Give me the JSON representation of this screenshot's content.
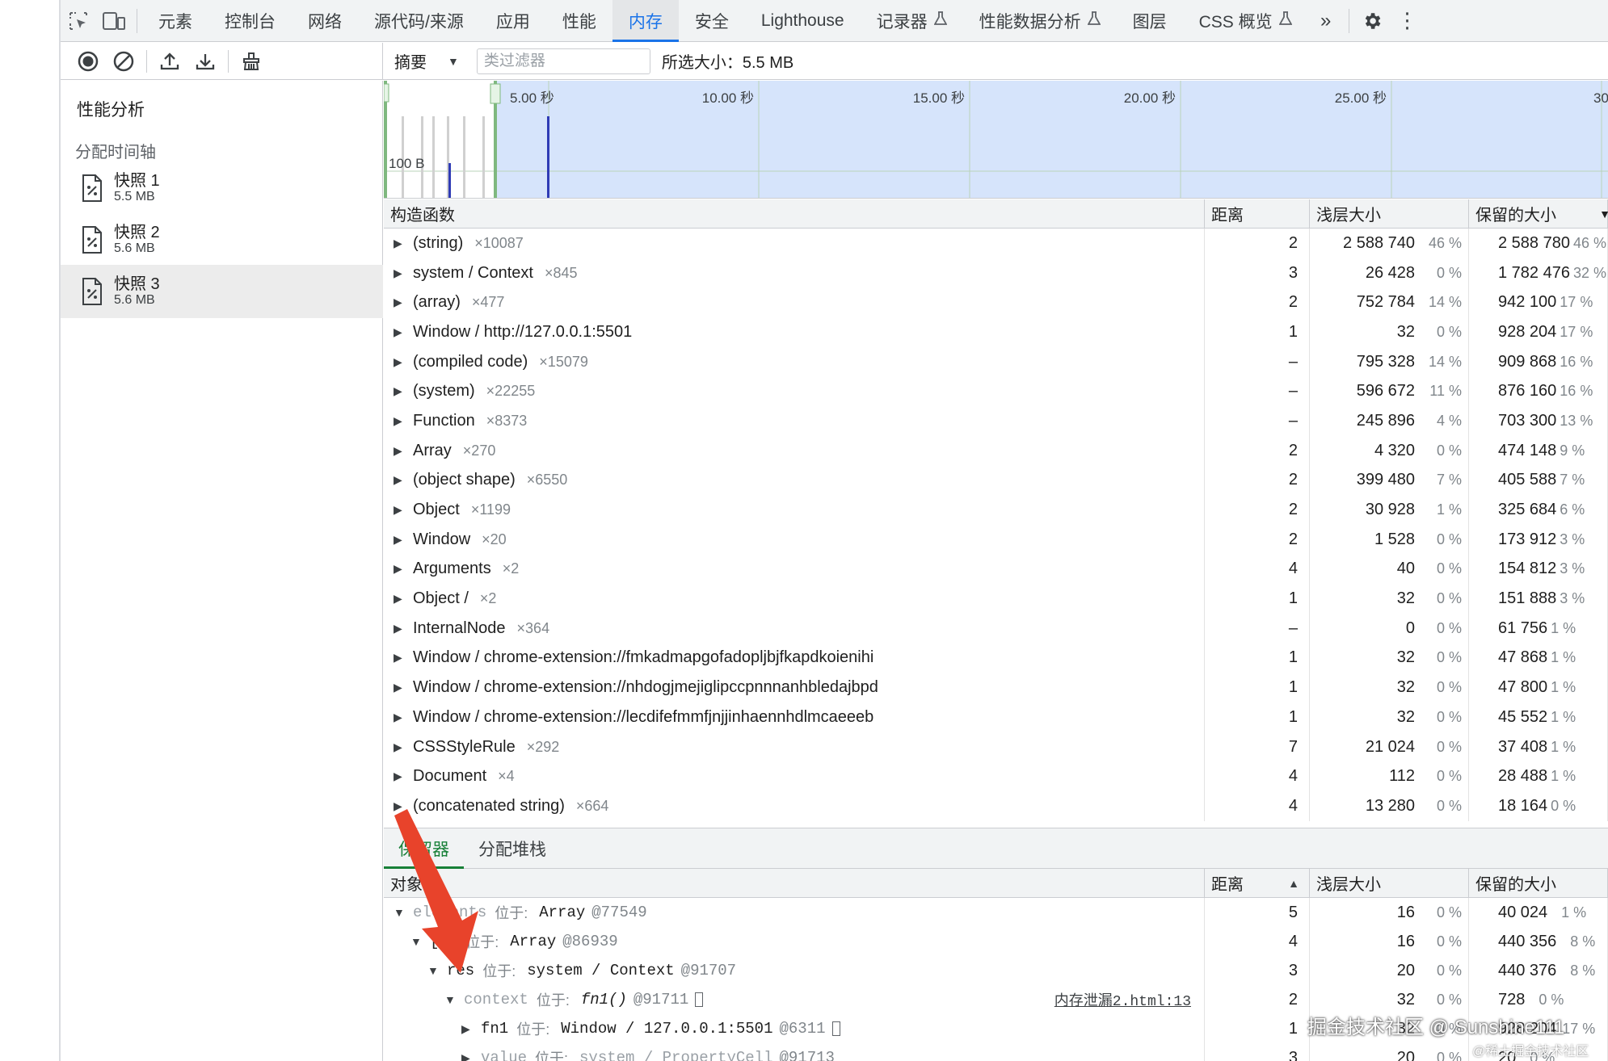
{
  "tabs": [
    {
      "label": "元素",
      "active": false,
      "flask": false
    },
    {
      "label": "控制台",
      "active": false,
      "flask": false
    },
    {
      "label": "网络",
      "active": false,
      "flask": false
    },
    {
      "label": "源代码/来源",
      "active": false,
      "flask": false
    },
    {
      "label": "应用",
      "active": false,
      "flask": false
    },
    {
      "label": "性能",
      "active": false,
      "flask": false
    },
    {
      "label": "内存",
      "active": true,
      "flask": false
    },
    {
      "label": "安全",
      "active": false,
      "flask": false
    },
    {
      "label": "Lighthouse",
      "active": false,
      "flask": false
    },
    {
      "label": "记录器",
      "active": false,
      "flask": true
    },
    {
      "label": "性能数据分析",
      "active": false,
      "flask": true
    },
    {
      "label": "图层",
      "active": false,
      "flask": false
    },
    {
      "label": "CSS 概览",
      "active": false,
      "flask": true
    }
  ],
  "toolbar": {
    "view_select": "摘要",
    "filter_placeholder": "类过滤器",
    "selected_size": "所选大小：5.5 MB"
  },
  "sidebar": {
    "title": "性能分析",
    "section": "分配时间轴",
    "snapshots": [
      {
        "name": "快照 1",
        "size": "5.5 MB",
        "selected": false
      },
      {
        "name": "快照 2",
        "size": "5.6 MB",
        "selected": false
      },
      {
        "name": "快照 3",
        "size": "5.6 MB",
        "selected": true
      }
    ]
  },
  "timeline": {
    "ticks": [
      "5.00 秒",
      "10.00 秒",
      "15.00 秒",
      "20.00 秒",
      "25.00 秒",
      "30"
    ],
    "y_label": "100 B"
  },
  "table": {
    "headers": {
      "name": "构造函数",
      "distance": "距离",
      "shallow": "浅层大小",
      "retained": "保留的大小"
    },
    "rows": [
      {
        "name": "(string)",
        "count": "×10087",
        "distance": "2",
        "shallow": "2 588 740",
        "shallow_pct": "46 %",
        "retained": "2 588 780",
        "retained_pct": "46 %"
      },
      {
        "name": "system / Context",
        "count": "×845",
        "distance": "3",
        "shallow": "26 428",
        "shallow_pct": "0 %",
        "retained": "1 782 476",
        "retained_pct": "32 %"
      },
      {
        "name": "(array)",
        "count": "×477",
        "distance": "2",
        "shallow": "752 784",
        "shallow_pct": "14 %",
        "retained": "942 100",
        "retained_pct": "17 %"
      },
      {
        "name": "Window / http://127.0.0.1:5501",
        "count": "",
        "distance": "1",
        "shallow": "32",
        "shallow_pct": "0 %",
        "retained": "928 204",
        "retained_pct": "17 %"
      },
      {
        "name": "(compiled code)",
        "count": "×15079",
        "distance": "–",
        "shallow": "795 328",
        "shallow_pct": "14 %",
        "retained": "909 868",
        "retained_pct": "16 %"
      },
      {
        "name": "(system)",
        "count": "×22255",
        "distance": "–",
        "shallow": "596 672",
        "shallow_pct": "11 %",
        "retained": "876 160",
        "retained_pct": "16 %"
      },
      {
        "name": "Function",
        "count": "×8373",
        "distance": "–",
        "shallow": "245 896",
        "shallow_pct": "4 %",
        "retained": "703 300",
        "retained_pct": "13 %"
      },
      {
        "name": "Array",
        "count": "×270",
        "distance": "2",
        "shallow": "4 320",
        "shallow_pct": "0 %",
        "retained": "474 148",
        "retained_pct": "9 %"
      },
      {
        "name": "(object shape)",
        "count": "×6550",
        "distance": "2",
        "shallow": "399 480",
        "shallow_pct": "7 %",
        "retained": "405 588",
        "retained_pct": "7 %"
      },
      {
        "name": "Object",
        "count": "×1199",
        "distance": "2",
        "shallow": "30 928",
        "shallow_pct": "1 %",
        "retained": "325 684",
        "retained_pct": "6 %"
      },
      {
        "name": "Window",
        "count": "×20",
        "distance": "2",
        "shallow": "1 528",
        "shallow_pct": "0 %",
        "retained": "173 912",
        "retained_pct": "3 %"
      },
      {
        "name": "Arguments",
        "count": "×2",
        "distance": "4",
        "shallow": "40",
        "shallow_pct": "0 %",
        "retained": "154 812",
        "retained_pct": "3 %"
      },
      {
        "name": "Object /",
        "count": "×2",
        "distance": "1",
        "shallow": "32",
        "shallow_pct": "0 %",
        "retained": "151 888",
        "retained_pct": "3 %"
      },
      {
        "name": "InternalNode",
        "count": "×364",
        "distance": "–",
        "shallow": "0",
        "shallow_pct": "0 %",
        "retained": "61 756",
        "retained_pct": "1 %"
      },
      {
        "name": "Window / chrome-extension://fmkadmapgofadopljbjfkapdkoienihi",
        "count": "",
        "distance": "1",
        "shallow": "32",
        "shallow_pct": "0 %",
        "retained": "47 868",
        "retained_pct": "1 %"
      },
      {
        "name": "Window / chrome-extension://nhdogjmejiglipccpnnnanhbledajbpd",
        "count": "",
        "distance": "1",
        "shallow": "32",
        "shallow_pct": "0 %",
        "retained": "47 800",
        "retained_pct": "1 %"
      },
      {
        "name": "Window / chrome-extension://lecdifefmmfjnjjinhaennhdlmcaeeeb",
        "count": "",
        "distance": "1",
        "shallow": "32",
        "shallow_pct": "0 %",
        "retained": "45 552",
        "retained_pct": "1 %"
      },
      {
        "name": "CSSStyleRule",
        "count": "×292",
        "distance": "7",
        "shallow": "21 024",
        "shallow_pct": "0 %",
        "retained": "37 408",
        "retained_pct": "1 %"
      },
      {
        "name": "Document",
        "count": "×4",
        "distance": "4",
        "shallow": "112",
        "shallow_pct": "0 %",
        "retained": "28 488",
        "retained_pct": "1 %"
      },
      {
        "name": "(concatenated string)",
        "count": "×664",
        "distance": "4",
        "shallow": "13 280",
        "shallow_pct": "0 %",
        "retained": "18 164",
        "retained_pct": "0 %"
      }
    ]
  },
  "bottom": {
    "tabs": [
      "保留器",
      "分配堆栈"
    ],
    "headers": {
      "name": "对象",
      "distance": "距离",
      "shallow": "浅层大小",
      "retained": "保留的大小"
    },
    "rows": [
      {
        "indent": 0,
        "open": true,
        "prop": "elements",
        "dim": true,
        "at": "位于:",
        "obj": "Array",
        "obj_dim": false,
        "italic": false,
        "id": "@77549",
        "link": "",
        "distance": "5",
        "shallow": "16",
        "shallow_pct": "0 %",
        "retained": "40 024",
        "retained_pct": "1 %"
      },
      {
        "indent": 1,
        "open": true,
        "prop": "[1]",
        "dim": false,
        "at": "位于:",
        "obj": "Array",
        "obj_dim": false,
        "italic": false,
        "id": "@86939",
        "link": "",
        "distance": "4",
        "shallow": "16",
        "shallow_pct": "0 %",
        "retained": "440 356",
        "retained_pct": "8 %"
      },
      {
        "indent": 2,
        "open": true,
        "prop": "res",
        "dim": false,
        "at": "位于:",
        "obj": "system / Context",
        "obj_dim": false,
        "italic": false,
        "id": "@91707",
        "link": "",
        "distance": "3",
        "shallow": "20",
        "shallow_pct": "0 %",
        "retained": "440 376",
        "retained_pct": "8 %"
      },
      {
        "indent": 3,
        "open": true,
        "prop": "context",
        "dim": true,
        "at": "位于:",
        "obj": "fn1()",
        "obj_dim": false,
        "italic": true,
        "id": "@91711",
        "link": "内存泄漏2.html:13",
        "distance": "2",
        "shallow": "32",
        "shallow_pct": "0 %",
        "retained": "728",
        "retained_pct": "0 %"
      },
      {
        "indent": 4,
        "open": false,
        "prop": "fn1",
        "dim": false,
        "at": "位于:",
        "obj": "Window / 127.0.0.1:5501",
        "obj_dim": false,
        "italic": false,
        "id": "@6311",
        "link": "",
        "distance": "1",
        "shallow": "32",
        "shallow_pct": "0 %",
        "retained": "928 204",
        "retained_pct": "17 %"
      },
      {
        "indent": 4,
        "open": false,
        "prop": "value",
        "dim": true,
        "at": "位于:",
        "obj": "system / PropertyCell",
        "obj_dim": true,
        "italic": false,
        "id": "@91713",
        "link": "",
        "distance": "3",
        "shallow": "20",
        "shallow_pct": "0 %",
        "retained": "20",
        "retained_pct": "0 %"
      }
    ]
  },
  "watermark": "掘金技术社区 @ Sunshine111",
  "watermark_small": "@稀土掘金技术社区",
  "colors": {
    "accent": "#1a73e8",
    "green_tab": "#188038",
    "timeline_fill": "#d6e4fb",
    "arrow": "#e8432b"
  },
  "icons": [
    "select-element-icon",
    "device-toolbar-icon",
    "more-tabs-icon",
    "settings-gear-icon",
    "kebab-menu-icon",
    "record-icon",
    "clear-icon",
    "upload-icon",
    "download-icon",
    "collect-garbage-icon",
    "snapshot-file-icon"
  ]
}
